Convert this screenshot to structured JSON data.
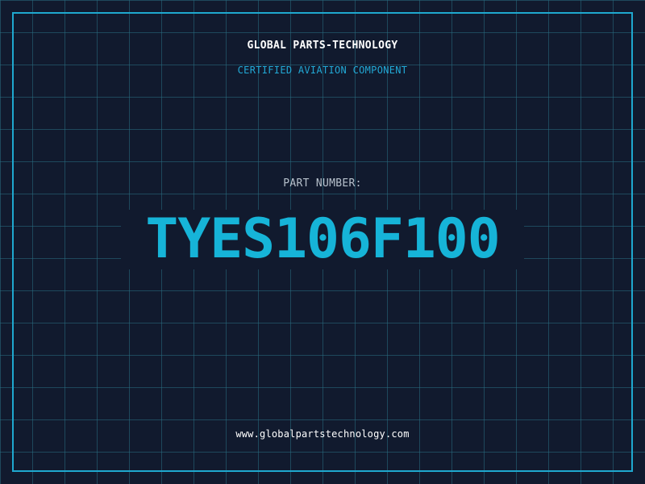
{
  "header": {
    "company": "GLOBAL PARTS-TECHNOLOGY",
    "subtitle": "CERTIFIED AVIATION COMPONENT"
  },
  "main": {
    "label": "PART NUMBER:",
    "part_number": "TYES106F100"
  },
  "footer": {
    "website": "www.globalpartstechnology.com"
  },
  "colors": {
    "background": "#111a2e",
    "grid": "#286e82",
    "accent": "#1fa8cf",
    "part_number": "#16b4d8"
  }
}
